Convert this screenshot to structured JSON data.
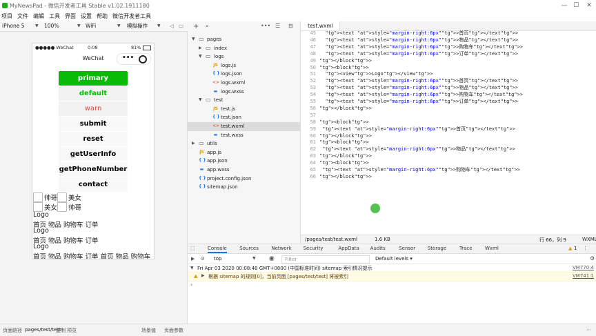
{
  "window": {
    "title": "MyNewsPad - 微信开发者工具 Stable v1.02.1911180"
  },
  "menu": [
    "项目",
    "文件",
    "编辑",
    "工具",
    "界面",
    "设置",
    "帮助",
    "微信开发者工具"
  ],
  "toolbar": {
    "device": "iPhone 5",
    "zoom": "100%",
    "network": "WiFi",
    "mode": "模拟操作"
  },
  "phone": {
    "carrier": "●●●●● WeChat",
    "time": "0:08",
    "battery": "81%",
    "nav_title": "WeChat",
    "buttons": [
      "primary",
      "default",
      "warn",
      "submit",
      "reset",
      "getUserInfo",
      "getPhoneNumber",
      "contact"
    ],
    "checks": [
      [
        "帅哥",
        "美女"
      ],
      [
        "美女",
        "帅哥"
      ]
    ],
    "lines": [
      "Logo",
      "首页 物品 购物车 订单",
      "Logo",
      "首页 物品 购物车 订单",
      "Logo",
      "首页 物品 购物车 订单 首页 物品 购物车"
    ]
  },
  "tree": [
    {
      "name": "pages",
      "indent": 0,
      "type": "folder",
      "open": true
    },
    {
      "name": "index",
      "indent": 1,
      "type": "folder",
      "open": false
    },
    {
      "name": "logs",
      "indent": 1,
      "type": "folder",
      "open": true
    },
    {
      "name": "logs.js",
      "indent": 2,
      "type": "js"
    },
    {
      "name": "logs.json",
      "indent": 2,
      "type": "json"
    },
    {
      "name": "logs.wxml",
      "indent": 2,
      "type": "wxml"
    },
    {
      "name": "logs.wxss",
      "indent": 2,
      "type": "wxss"
    },
    {
      "name": "test",
      "indent": 1,
      "type": "folder",
      "open": true
    },
    {
      "name": "test.js",
      "indent": 2,
      "type": "js"
    },
    {
      "name": "test.json",
      "indent": 2,
      "type": "json"
    },
    {
      "name": "test.wxml",
      "indent": 2,
      "type": "wxml",
      "selected": true
    },
    {
      "name": "test.wxss",
      "indent": 2,
      "type": "wxss"
    },
    {
      "name": "utils",
      "indent": 0,
      "type": "folder",
      "open": false
    },
    {
      "name": "app.js",
      "indent": 0,
      "type": "js"
    },
    {
      "name": "app.json",
      "indent": 0,
      "type": "json"
    },
    {
      "name": "app.wxss",
      "indent": 0,
      "type": "wxss"
    },
    {
      "name": "project.config.json",
      "indent": 0,
      "type": "json"
    },
    {
      "name": "sitemap.json",
      "indent": 0,
      "type": "json"
    }
  ],
  "editor": {
    "tab": "test.wxml",
    "lines": [
      [
        "45",
        "  <text style=\"margin-right:6px\">首页</text>"
      ],
      [
        "46",
        "  <text style=\"margin-right:6px\">物品</text>"
      ],
      [
        "47",
        "  <text style=\"margin-right:6px\">购物车</text>"
      ],
      [
        "48",
        "  <text style=\"margin-right:6px\">订单</text>"
      ],
      [
        "49",
        "</block>"
      ],
      [
        "50",
        "<block>"
      ],
      [
        "51",
        "  <view>Logo</view>"
      ],
      [
        "52",
        "  <text style=\"margin-right:6px\">首页</text>"
      ],
      [
        "53",
        "  <text style=\"margin-right:6px\">物品</text>"
      ],
      [
        "54",
        "  <text style=\"margin-right:6px\">购物车</text>"
      ],
      [
        "55",
        "  <text style=\"margin-right:6px\">订单</text>"
      ],
      [
        "56",
        "</block>"
      ],
      [
        "57",
        ""
      ],
      [
        "58",
        "<block>"
      ],
      [
        "59",
        " <text style=\"margin-right:6px\">首页</text>"
      ],
      [
        "60",
        "</block>"
      ],
      [
        "61",
        "<block>"
      ],
      [
        "62",
        " <text style=\"margin-right:6px\">物品</text>"
      ],
      [
        "63",
        "</block>"
      ],
      [
        "64",
        "<block>"
      ],
      [
        "65",
        " <text style=\"margin-right:6px\">购物车</text>"
      ],
      [
        "66",
        "</block>"
      ]
    ],
    "path": "/pages/test/test.wxml",
    "size": "1.6 KB",
    "cursor": "行 66，列 9",
    "lang": "WXML"
  },
  "devtools": {
    "tabs": [
      "Console",
      "Sources",
      "Network",
      "Security",
      "AppData",
      "Audits",
      "Sensor",
      "Storage",
      "Trace",
      "Wxml"
    ],
    "warn_count": "1",
    "context": "top",
    "filter_placeholder": "Filter",
    "levels": "Default levels",
    "log1": "Fri Apr 03 2020 00:08:48 GMT+0800 (中国标准时间) sitemap 索引情况提示",
    "log1_src": "VM770:4",
    "log2": "根据 sitemap 的规则[0]，当前页面 [pages/test/test] 将被索引",
    "log2_src": "VM741:1"
  },
  "bottom": {
    "path_label": "页面路径",
    "path": "pages/test/test",
    "copy": "复制",
    "preview": "预览",
    "scene": "场景值",
    "params": "页面参数"
  },
  "colors": {
    "primary": "#09bb07",
    "warn": "#e64340"
  }
}
